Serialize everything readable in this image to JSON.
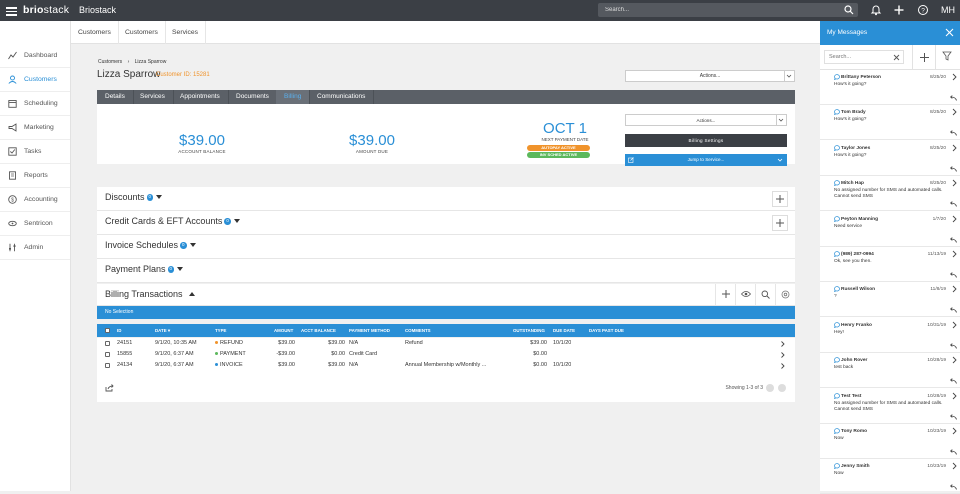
{
  "topbar": {
    "logo_bold": "brio",
    "logo_rest": "stack",
    "app_name": "Briostack",
    "search_placeholder": "Search...",
    "user_initials": "MH"
  },
  "leftnav": {
    "items": [
      {
        "label": "Dashboard",
        "icon": "chart-line-icon",
        "active": false
      },
      {
        "label": "Customers",
        "icon": "user-icon",
        "active": true
      },
      {
        "label": "Scheduling",
        "icon": "calendar-icon",
        "active": false
      },
      {
        "label": "Marketing",
        "icon": "bullhorn-icon",
        "active": false
      },
      {
        "label": "Tasks",
        "icon": "checkbox-icon",
        "active": false
      },
      {
        "label": "Reports",
        "icon": "document-icon",
        "active": false
      },
      {
        "label": "Accounting",
        "icon": "dollar-circle-icon",
        "active": false
      },
      {
        "label": "Sentricon",
        "icon": "sentricon-icon",
        "active": false
      },
      {
        "label": "Admin",
        "icon": "sliders-icon",
        "active": false
      }
    ]
  },
  "subnav": {
    "tabs": [
      "Customers",
      "Customers",
      "Services"
    ]
  },
  "breadcrumb": {
    "first": "Customers",
    "second": "Lizza Sparrow"
  },
  "customer": {
    "name": "Lizza Sparrow",
    "id_label": "Customer ID: 15281"
  },
  "actions_label": "Actions...",
  "tabs": [
    {
      "label": "Details",
      "active": false
    },
    {
      "label": "Services",
      "active": false
    },
    {
      "label": "Appointments",
      "active": false
    },
    {
      "label": "Documents",
      "active": false
    },
    {
      "label": "Billing",
      "active": true
    },
    {
      "label": "Communications",
      "active": false
    }
  ],
  "billing": {
    "account_balance": "$39.00",
    "account_balance_label": "ACCOUNT BALANCE",
    "amount_due": "$39.00",
    "amount_due_label": "AMOUNT DUE",
    "next_payment_date": "OCT 1",
    "next_payment_label": "NEXT PAYMENT DATE",
    "pills": [
      {
        "label": "AUTOPAY ACTIVE",
        "color": "#f0932b"
      },
      {
        "label": "INV SCHED ACTIVE",
        "color": "#5cb85c"
      }
    ],
    "actions_label": "Actions...",
    "settings_label": "Billing Settings",
    "jump_label": "Jump to Service..."
  },
  "sections": [
    {
      "title": "Discounts",
      "count": "0"
    },
    {
      "title": "Credit Cards & EFT Accounts",
      "count": "0"
    },
    {
      "title": "Invoice Schedules",
      "count": "0"
    },
    {
      "title": "Payment Plans",
      "count": "0"
    }
  ],
  "transactions": {
    "title": "Billing Transactions",
    "no_selection": "No Selection",
    "columns": [
      "ID",
      "DATE",
      "TYPE",
      "AMOUNT",
      "ACCT BALANCE",
      "PAYMENT METHOD",
      "COMMENTS",
      "OUTSTANDING",
      "DUE DATE",
      "DAYS PAST DUE"
    ],
    "rows": [
      {
        "id": "24151",
        "date": "9/1/20, 10:35 AM",
        "type": "REFUND",
        "type_color": "#f0932b",
        "amount": "$39.00",
        "acct_balance": "$39.00",
        "payment_method": "N/A",
        "comments": "Refund",
        "outstanding": "$39.00",
        "due_date": "10/1/20",
        "days_past_due": ""
      },
      {
        "id": "15855",
        "date": "9/1/20, 6:37 AM",
        "type": "PAYMENT",
        "type_color": "#5cb85c",
        "amount": "-$39.00",
        "acct_balance": "$0.00",
        "payment_method": "Credit Card",
        "comments": "",
        "outstanding": "$0.00",
        "due_date": "",
        "days_past_due": ""
      },
      {
        "id": "24134",
        "date": "9/1/20, 6:37 AM",
        "type": "INVOICE",
        "type_color": "#2a8fd6",
        "amount": "$39.00",
        "acct_balance": "$39.00",
        "payment_method": "N/A",
        "comments": "Annual Membership w/Monthly ...",
        "outstanding": "$0.00",
        "due_date": "10/1/20",
        "days_past_due": ""
      }
    ],
    "showing": "Showing 1-3 of 3"
  },
  "messages_panel": {
    "title": "My Messages",
    "search_placeholder": "Search...",
    "messages": [
      {
        "name": "Brittany Peterson",
        "date": "8/25/20",
        "text": "How's it going?"
      },
      {
        "name": "Tom Brady",
        "date": "8/25/20",
        "text": "How's it going?"
      },
      {
        "name": "Taylor Jones",
        "date": "8/25/20",
        "text": "How's it going?"
      },
      {
        "name": "Mitch Hap",
        "date": "8/25/20",
        "text": "No assigned number for SMS and automated calls. Cannot send SMS"
      },
      {
        "name": "Peyton Manning",
        "date": "1/7/20",
        "text": "Need service"
      },
      {
        "name": "(989) 287-0994",
        "date": "11/13/19",
        "text": "Ok, see you then."
      },
      {
        "name": "Russell Wilson",
        "date": "11/8/19",
        "text": "?"
      },
      {
        "name": "Henry Franko",
        "date": "10/31/19",
        "text": "Hey!"
      },
      {
        "name": "John Rover",
        "date": "10/28/19",
        "text": "test back"
      },
      {
        "name": "Test Test",
        "date": "10/28/19",
        "text": "No assigned number for SMS and automated calls. Cannot send SMS"
      },
      {
        "name": "Tony Romo",
        "date": "10/23/19",
        "text": "Now"
      },
      {
        "name": "Jenny Smith",
        "date": "10/23/19",
        "text": "Now"
      }
    ]
  }
}
